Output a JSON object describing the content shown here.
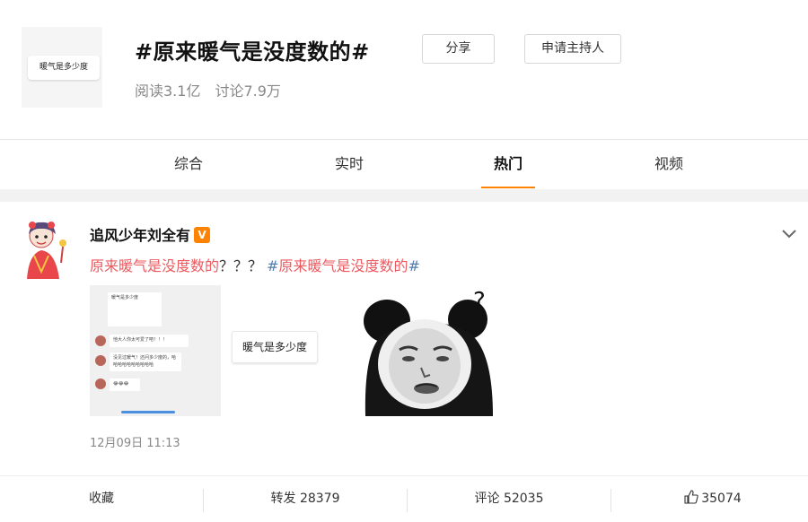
{
  "topic": {
    "thumb_caption": "暖气是多少度",
    "title": "#原来暖气是没度数的#",
    "share_label": "分享",
    "host_label": "申请主持人",
    "reads": "阅读3.1亿",
    "discussions": "讨论7.9万"
  },
  "tabs": [
    {
      "label": "综合",
      "active": false
    },
    {
      "label": "实时",
      "active": false
    },
    {
      "label": "热门",
      "active": true
    },
    {
      "label": "视频",
      "active": false
    }
  ],
  "post": {
    "author": "追风少年刘全有",
    "verified_badge": "V",
    "text_red": "原来暖气是没度数的",
    "text_marks": "？？？",
    "hashtag": "#原来暖气是没度数的#",
    "image1": {
      "bubble_top": "暖气是多少度",
      "msg1": "他大人你太可爱了吧！！！",
      "msg2": "没见过暖气！还问多少度的，哈哈哈哈哈哈哈哈哈哈",
      "msg3": "😂😂😂"
    },
    "sticker_text": "暖气是多少度",
    "timestamp": "12月09日 11:13"
  },
  "actions": {
    "favorite": "收藏",
    "repost": "转发 28379",
    "comment": "评论 52035",
    "like": "35074"
  },
  "colors": {
    "accent": "#ff8200",
    "hashtag_red": "#eb5a5f",
    "link_blue": "#507daf"
  }
}
